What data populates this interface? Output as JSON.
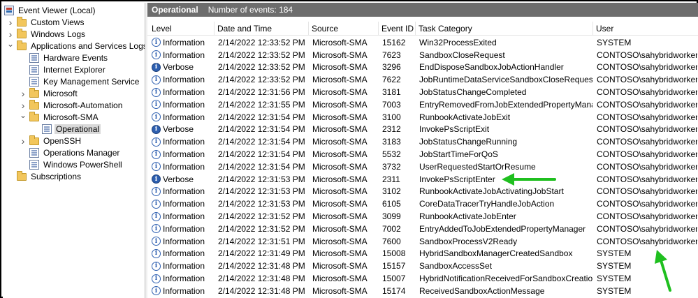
{
  "tree": {
    "root": "Event Viewer (Local)",
    "items": [
      {
        "label": "Custom Views",
        "depth": 1,
        "expand": "collapsed",
        "icon": "folder-icon"
      },
      {
        "label": "Windows Logs",
        "depth": 1,
        "expand": "collapsed",
        "icon": "folder-icon"
      },
      {
        "label": "Applications and Services Logs",
        "depth": 1,
        "expand": "expanded",
        "icon": "folder-icon"
      },
      {
        "label": "Hardware Events",
        "depth": 2,
        "expand": "none",
        "icon": "log-icon"
      },
      {
        "label": "Internet Explorer",
        "depth": 2,
        "expand": "none",
        "icon": "log-icon"
      },
      {
        "label": "Key Management Service",
        "depth": 2,
        "expand": "none",
        "icon": "log-icon"
      },
      {
        "label": "Microsoft",
        "depth": 2,
        "expand": "collapsed",
        "icon": "folder-icon"
      },
      {
        "label": "Microsoft-Automation",
        "depth": 2,
        "expand": "collapsed",
        "icon": "folder-icon"
      },
      {
        "label": "Microsoft-SMA",
        "depth": 2,
        "expand": "expanded",
        "icon": "folder-icon"
      },
      {
        "label": "Operational",
        "depth": 3,
        "expand": "none",
        "icon": "log-icon",
        "selected": true
      },
      {
        "label": "OpenSSH",
        "depth": 2,
        "expand": "collapsed",
        "icon": "folder-icon"
      },
      {
        "label": "Operations Manager",
        "depth": 2,
        "expand": "none",
        "icon": "log-icon"
      },
      {
        "label": "Windows PowerShell",
        "depth": 2,
        "expand": "none",
        "icon": "log-icon"
      },
      {
        "label": "Subscriptions",
        "depth": 1,
        "expand": "none",
        "icon": "subscriptions-icon"
      }
    ]
  },
  "header": {
    "log_name": "Operational",
    "count_text": "Number of events: 184"
  },
  "columns": [
    "Level",
    "Date and Time",
    "Source",
    "Event ID",
    "Task Category",
    "User"
  ],
  "events": [
    [
      "Information",
      "2/14/2022 12:33:52 PM",
      "Microsoft-SMA",
      "15162",
      "Win32ProcessExited",
      "SYSTEM"
    ],
    [
      "Information",
      "2/14/2022 12:33:52 PM",
      "Microsoft-SMA",
      "7623",
      "SandboxCloseRequest",
      "CONTOSO\\sahybridworker"
    ],
    [
      "Verbose",
      "2/14/2022 12:33:52 PM",
      "Microsoft-SMA",
      "3296",
      "EndDisposeSandboxJobActionHandler",
      "CONTOSO\\sahybridworker"
    ],
    [
      "Information",
      "2/14/2022 12:33:52 PM",
      "Microsoft-SMA",
      "7622",
      "JobRuntimeDataServiceSandboxCloseRequest",
      "CONTOSO\\sahybridworker"
    ],
    [
      "Information",
      "2/14/2022 12:31:56 PM",
      "Microsoft-SMA",
      "3181",
      "JobStatusChangeCompleted",
      "CONTOSO\\sahybridworker"
    ],
    [
      "Information",
      "2/14/2022 12:31:55 PM",
      "Microsoft-SMA",
      "7003",
      "EntryRemovedFromJobExtendedPropertyMana...",
      "CONTOSO\\sahybridworker"
    ],
    [
      "Information",
      "2/14/2022 12:31:54 PM",
      "Microsoft-SMA",
      "3100",
      "RunbookActivateJobExit",
      "CONTOSO\\sahybridworker"
    ],
    [
      "Verbose",
      "2/14/2022 12:31:54 PM",
      "Microsoft-SMA",
      "2312",
      "InvokePsScriptExit",
      "CONTOSO\\sahybridworker"
    ],
    [
      "Information",
      "2/14/2022 12:31:54 PM",
      "Microsoft-SMA",
      "3183",
      "JobStatusChangeRunning",
      "CONTOSO\\sahybridworker"
    ],
    [
      "Information",
      "2/14/2022 12:31:54 PM",
      "Microsoft-SMA",
      "5532",
      "JobStartTimeForQoS",
      "CONTOSO\\sahybridworker"
    ],
    [
      "Information",
      "2/14/2022 12:31:54 PM",
      "Microsoft-SMA",
      "3732",
      "UserRequestedStartOrResume",
      "CONTOSO\\sahybridworker"
    ],
    [
      "Verbose",
      "2/14/2022 12:31:53 PM",
      "Microsoft-SMA",
      "2311",
      "InvokePsScriptEnter",
      "CONTOSO\\sahybridworker"
    ],
    [
      "Information",
      "2/14/2022 12:31:53 PM",
      "Microsoft-SMA",
      "3102",
      "RunbookActivateJobActivatingJobStart",
      "CONTOSO\\sahybridworker"
    ],
    [
      "Information",
      "2/14/2022 12:31:53 PM",
      "Microsoft-SMA",
      "6105",
      "CoreDataTracerTryHandleJobAction",
      "CONTOSO\\sahybridworker"
    ],
    [
      "Information",
      "2/14/2022 12:31:52 PM",
      "Microsoft-SMA",
      "3099",
      "RunbookActivateJobEnter",
      "CONTOSO\\sahybridworker"
    ],
    [
      "Information",
      "2/14/2022 12:31:52 PM",
      "Microsoft-SMA",
      "7002",
      "EntryAddedToJobExtendedPropertyManager",
      "CONTOSO\\sahybridworker"
    ],
    [
      "Information",
      "2/14/2022 12:31:51 PM",
      "Microsoft-SMA",
      "7600",
      "SandboxProcessV2Ready",
      "CONTOSO\\sahybridworker"
    ],
    [
      "Information",
      "2/14/2022 12:31:49 PM",
      "Microsoft-SMA",
      "15008",
      "HybridSandboxManagerCreatedSandbox",
      "SYSTEM"
    ],
    [
      "Information",
      "2/14/2022 12:31:48 PM",
      "Microsoft-SMA",
      "15157",
      "SandboxAccessSet",
      "SYSTEM"
    ],
    [
      "Information",
      "2/14/2022 12:31:48 PM",
      "Microsoft-SMA",
      "15007",
      "HybridNotificationReceivedForSandboxCreation",
      "SYSTEM"
    ],
    [
      "Information",
      "2/14/2022 12:31:48 PM",
      "Microsoft-SMA",
      "15174",
      "ReceivedSandboxActionMessage",
      "SYSTEM"
    ]
  ],
  "annotations": {
    "arrow_color": "#1fbf1f"
  },
  "colors": {
    "title_bar": "#6d6d6d",
    "info_icon": "#2d5fb0",
    "selected_bg": "#d9d9d9"
  }
}
